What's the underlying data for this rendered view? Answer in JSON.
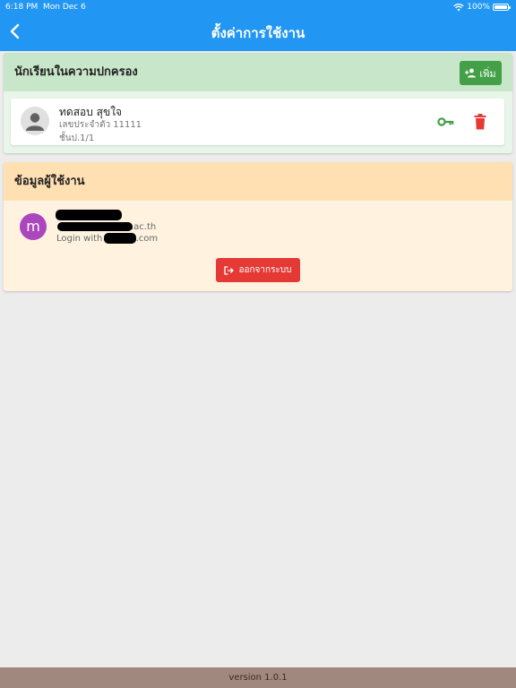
{
  "status_bar": {
    "time": "6:18 PM",
    "date": "Mon Dec 6",
    "battery": "100%"
  },
  "nav": {
    "title": "ตั้งค่าการใช้งาน"
  },
  "students_section": {
    "title": "นักเรียนในความปกครอง",
    "add_button_label": "เพิ่ม",
    "students": [
      {
        "name": "ทดสอบ สุขใจ",
        "id_line": "เลขประจำตัว 11111",
        "class_line": "ชั้นป.1/1"
      }
    ]
  },
  "user_section": {
    "title": "ข้อมูลผู้ใช้งาน",
    "avatar_letter": "m",
    "email_suffix": ".ac.th",
    "login_prefix": "Login with",
    "login_suffix": ".com",
    "logout_button_label": "ออกจากระบบ"
  },
  "footer": {
    "version": "version 1.0.1"
  },
  "colors": {
    "header": "#2196f3",
    "students_header": "#c8e6c9",
    "user_header": "#ffe0b2",
    "add_button": "#43a047",
    "logout_button": "#e53935",
    "avatar": "#ab47bc",
    "footer": "#a1887f"
  }
}
